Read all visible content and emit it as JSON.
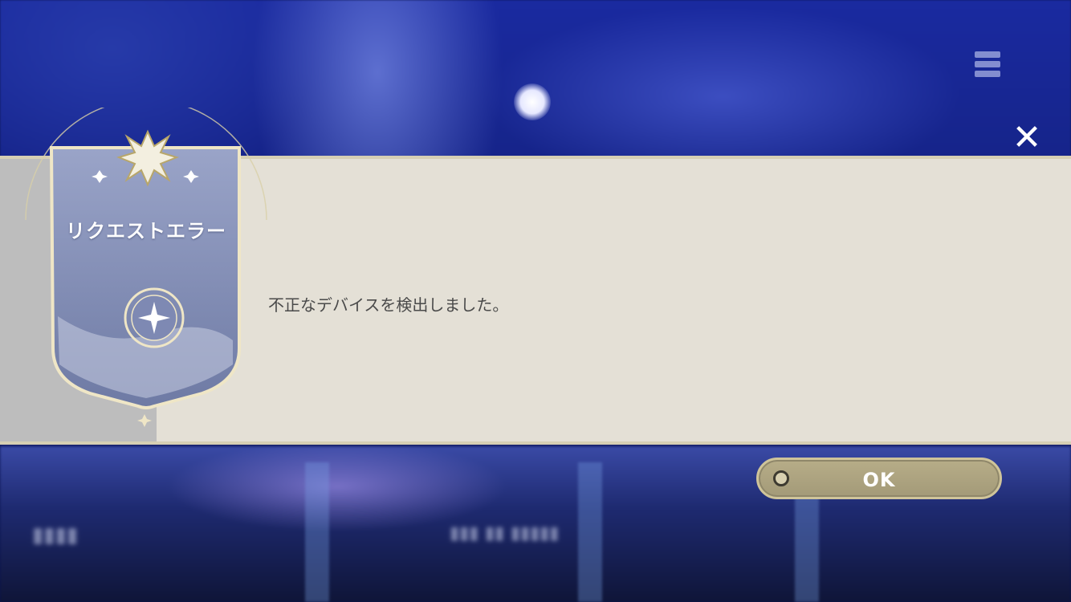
{
  "dialog": {
    "title": "リクエストエラー",
    "message": "不正なデバイスを検出しました。",
    "ok_label": "OK"
  },
  "icons": {
    "close": "close-icon",
    "menu": "menu-icon",
    "confirm_circle": "circle-icon",
    "emblem_star": "star-icon"
  },
  "colors": {
    "banner": "#e4e0d6",
    "banner_left": "#bdbdbd",
    "emblem": "#8e98b8",
    "button": "#ada482",
    "message_text": "#4a4a4a"
  }
}
